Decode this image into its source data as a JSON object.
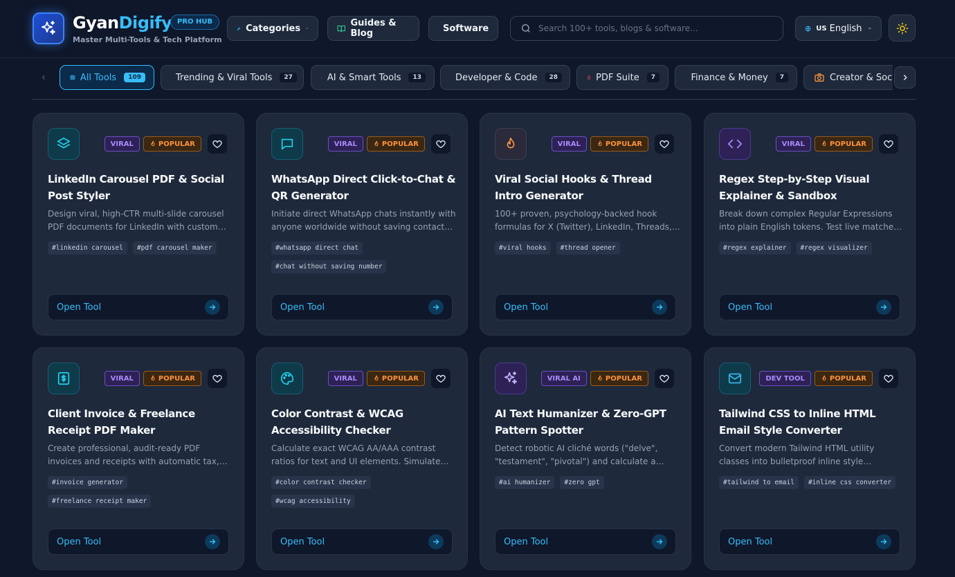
{
  "header": {
    "brand_part1": "Gyan",
    "brand_part2": "Digify",
    "badge": "PRO HUB",
    "tagline": "Master Multi-Tools & Tech Platform",
    "nav": {
      "categories": "Categories",
      "guides": "Guides & Blog",
      "software": "Software"
    },
    "search_placeholder": "Search 100+ tools, blogs & software...",
    "language_code": "US",
    "language": "English"
  },
  "categories": [
    {
      "label": "All Tools",
      "count": "109",
      "icon": "grid-icon",
      "active": true
    },
    {
      "label": "Trending & Viral Tools",
      "count": "27",
      "icon": "flame-icon"
    },
    {
      "label": "AI & Smart Tools",
      "count": "13",
      "icon": "sparkles-icon"
    },
    {
      "label": "Developer & Code",
      "count": "28",
      "icon": "code-icon"
    },
    {
      "label": "PDF Suite",
      "count": "7",
      "icon": "file-icon"
    },
    {
      "label": "Finance & Money",
      "count": "7",
      "icon": "trending-up-icon"
    },
    {
      "label": "Creator & Soci",
      "count": "",
      "icon": "camera-icon"
    }
  ],
  "cards": [
    {
      "icon": "layers-icon",
      "badge1": "VIRAL",
      "badge2": "POPULAR",
      "title": "LinkedIn Carousel PDF & Social Post Styler",
      "description": "Design viral, high-CTR multi-slide carousel PDF documents for LinkedIn with custom themes, branding and export.",
      "tags": [
        "#linkedin carousel",
        "#pdf carousel maker"
      ],
      "cta": "Open Tool"
    },
    {
      "icon": "chat-icon",
      "badge1": "VIRAL",
      "badge2": "POPULAR",
      "title": "WhatsApp Direct Click-to-Chat & QR Generator",
      "description": "Initiate direct WhatsApp chats instantly with anyone worldwide without saving contacts in your phone.",
      "tags": [
        "#whatsapp direct chat",
        "#chat without saving number"
      ],
      "cta": "Open Tool"
    },
    {
      "icon": "flame-icon",
      "badge1": "VIRAL",
      "badge2": "POPULAR",
      "title": "Viral Social Hooks & Thread Intro Generator",
      "description": "100+ proven, psychology-backed hook formulas for X (Twitter), LinkedIn, Threads, and more.",
      "tags": [
        "#viral hooks",
        "#thread opener"
      ],
      "cta": "Open Tool"
    },
    {
      "icon": "code-icon",
      "badge1": "VIRAL",
      "badge2": "POPULAR",
      "title": "Regex Step-by-Step Visual Explainer & Sandbox",
      "description": "Break down complex Regular Expressions into plain English tokens. Test live matches, inspect groups.",
      "tags": [
        "#regex explainer",
        "#regex visualizer"
      ],
      "cta": "Open Tool"
    },
    {
      "icon": "invoice-icon",
      "badge1": "VIRAL",
      "badge2": "POPULAR",
      "title": "Client Invoice & Freelance Receipt PDF Maker",
      "description": "Create professional, audit-ready PDF invoices and receipts with automatic tax, discount, and totals.",
      "tags": [
        "#invoice generator",
        "#freelance receipt maker"
      ],
      "cta": "Open Tool"
    },
    {
      "icon": "palette-icon",
      "badge1": "VIRAL",
      "badge2": "POPULAR",
      "title": "Color Contrast & WCAG Accessibility Checker",
      "description": "Calculate exact WCAG AA/AAA contrast ratios for text and UI elements. Simulate color blindness.",
      "tags": [
        "#color contrast checker",
        "#wcag accessibility"
      ],
      "cta": "Open Tool"
    },
    {
      "icon": "sparkles-icon",
      "badge1": "VIRAL AI",
      "badge2": "POPULAR",
      "title": "AI Text Humanizer & Zero-GPT Pattern Spotter",
      "description": "Detect robotic AI cliché words (\"delve\", \"testament\", \"pivotal\") and calculate a human score.",
      "tags": [
        "#ai humanizer",
        "#zero gpt"
      ],
      "cta": "Open Tool"
    },
    {
      "icon": "mail-icon",
      "badge1": "DEV TOOL",
      "badge2": "POPULAR",
      "title": "Tailwind CSS to Inline HTML Email Style Converter",
      "description": "Convert modern Tailwind HTML utility classes into bulletproof inline style attributes for email.",
      "tags": [
        "#tailwind to email",
        "#inline css converter"
      ],
      "cta": "Open Tool"
    }
  ],
  "colors": {
    "background": "#0f172a",
    "card": "#1e293b",
    "accent": "#38bdf8",
    "viral": "#a78bfa",
    "popular": "#fb923c"
  }
}
